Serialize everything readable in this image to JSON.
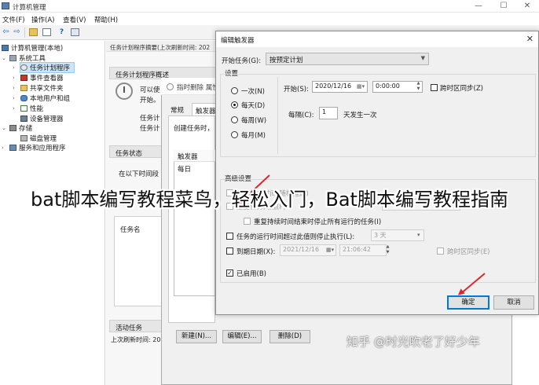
{
  "window": {
    "title": "计算机管理",
    "min_glyph": "—",
    "max_glyph": "☐",
    "close_glyph": "✕"
  },
  "menu": {
    "items": [
      "文件(F)",
      "操作(A)",
      "查看(V)",
      "帮助(H)"
    ]
  },
  "toolbar": {
    "back_icon": "arrow-left-icon",
    "forward_icon": "arrow-right-icon",
    "back_glyph": "⇦",
    "forward_glyph": "⇨",
    "help_glyph": "?"
  },
  "tree": {
    "root": "计算机管理(本地)",
    "system_tools": "系统工具",
    "task_scheduler": "任务计划程序",
    "event_viewer": "事件查看器",
    "shared_folders": "共享文件夹",
    "local_users": "本地用户和组",
    "performance": "性能",
    "device_manager": "设备管理器",
    "storage": "存储",
    "disk_management": "磁盘管理",
    "services": "服务和应用程序"
  },
  "middle": {
    "header": "任务计划程序摘要(上次刷新时间: 202",
    "overview_title": "任务计划程序概述",
    "overview_line1": "可以使",
    "overview_line2": "开始。",
    "overview_line3": "任务计",
    "overview_line4": "任务计",
    "status_title": "任务状态",
    "status_line": "在以下时间段",
    "task_name_header": "任务名",
    "active_tasks_title": "活动任务",
    "last_refresh": "上次刷新时间: 20"
  },
  "trigger_dialog": {
    "title": "指时删除  属性",
    "tab_general": "常规",
    "tab_triggers": "触发器",
    "tab_more": "操",
    "create_hint": "创建任务时，",
    "col_trigger": "触发器",
    "row_daily": "每日",
    "new_button": "新建(N)...",
    "edit_button": "编辑(E)...",
    "delete_button": "删除(D)"
  },
  "edit_dialog": {
    "title": "编辑触发器",
    "close_glyph": "✕",
    "begin_task_label": "开始任务(G):",
    "begin_task_value": "按预定计划",
    "settings_label": "设置",
    "once": "一次(N)",
    "daily": "每天(D)",
    "weekly": "每周(W)",
    "monthly": "每月(M)",
    "start_label": "开始(S):",
    "start_date": "2020/12/16",
    "start_time": "0:00:00",
    "sync_label": "跨时区同步(Z)",
    "recur_label": "每隔(C):",
    "recur_value": "1",
    "recur_suffix": "天发生一次",
    "advanced_label": "高级设置",
    "delay_label": "延迟任务时间(随机延迟)",
    "repeat_label": "重复任务间隔(P)",
    "stop_repeat_label": "重复持续时间结束时停止所有运行的任务(I)",
    "stop_if_longer_label": "任务的运行时间超过此值则停止执行(L):",
    "stop_if_longer_value": "3 天",
    "expire_label": "到期日期(X):",
    "expire_date": "2021/12/16",
    "expire_time": "21:06:42",
    "expire_sync_label": "跨时区同步(E)",
    "enabled_label": "已启用(B)",
    "enabled_check": "✓",
    "ok_button": "确定",
    "cancel_button": "取消"
  },
  "overlay": {
    "caption": "bat脚本编写教程菜鸟，轻松入门，Bat脚本编写教程指南",
    "watermark": "知乎 @时光吹老了好少年"
  },
  "colors": {
    "accent": "#0078d7",
    "arrow": "#d9282f",
    "selection": "#cce4f7"
  }
}
